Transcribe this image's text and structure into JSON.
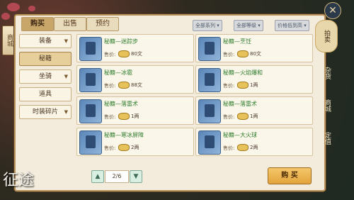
{
  "left_side_tab": "商城",
  "tabs": [
    {
      "label": "购买"
    },
    {
      "label": "出售"
    },
    {
      "label": "预约"
    }
  ],
  "filters": [
    {
      "label": "全部系列"
    },
    {
      "label": "全部等级"
    },
    {
      "label": "价格低到高"
    }
  ],
  "categories": [
    {
      "label": "装备",
      "has_arrow": true
    },
    {
      "label": "秘籍",
      "has_arrow": false
    },
    {
      "label": "坐骑",
      "has_arrow": true
    },
    {
      "label": "道具",
      "has_arrow": false
    },
    {
      "label": "时装碎片",
      "has_arrow": true
    }
  ],
  "items": [
    {
      "name": "秘籍—迷踪步",
      "price_label": "售价:",
      "price": "80文"
    },
    {
      "name": "秘籍—烹饪",
      "price_label": "售价:",
      "price": "80文"
    },
    {
      "name": "秘籍—冰雹",
      "price_label": "售价:",
      "price": "88文"
    },
    {
      "name": "秘籍—火焰爆和",
      "price_label": "售价:",
      "price": "1两"
    },
    {
      "name": "秘籍—落雷术",
      "price_label": "售价:",
      "price": "1两"
    },
    {
      "name": "秘籍—落雷术",
      "price_label": "售价:",
      "price": "1两"
    },
    {
      "name": "秘籍—寒冰屏障",
      "price_label": "售价:",
      "price": "2两"
    },
    {
      "name": "秘籍—大火球",
      "price_label": "售价:",
      "price": "2两"
    }
  ],
  "pagination": {
    "current": "2/6"
  },
  "buy_label": "购 买",
  "right_tabs": [
    {
      "label": "拍卖"
    },
    {
      "label": "杂货"
    },
    {
      "label": "商城"
    },
    {
      "label": "定值"
    }
  ],
  "logo_text": "征途"
}
